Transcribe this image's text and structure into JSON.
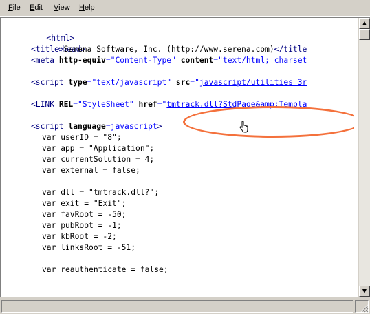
{
  "menu": [
    {
      "label": "File"
    },
    {
      "label": "Edit"
    },
    {
      "label": "View"
    },
    {
      "label": "Help"
    }
  ],
  "code": {
    "l1": "<html>",
    "l2": "<head>",
    "title_open": "<title>",
    "title_text": "Serena Software, Inc. (http://www.serena.com)",
    "title_close": "</title",
    "meta_open": "<meta",
    "meta_attr1": "http-equiv",
    "meta_val1": "\"Content-Type\"",
    "meta_attr2": "content",
    "meta_val2": "\"text/html; charset",
    "script1_open": "<script",
    "script1_attr1": "type",
    "script1_val1": "\"text/javascript\"",
    "script1_attr2": "src",
    "script1_val2_q": "\"",
    "script1_val2": "javascript/utilities 3r",
    "link_open": "<LINK",
    "link_attr1": "REL",
    "link_val1": "\"StyleSheet\"",
    "link_attr2": "href",
    "link_val2_q": "\"",
    "link_val2": "tmtrack.dll?StdPage&amp;Templa",
    "script2_open": "<script",
    "script2_attr": "language",
    "script2_val": "javascript",
    "script2_close": ">",
    "v1": "var userID = \"8\";",
    "v2": "var app = \"Application\";",
    "v3": "var currentSolution = 4;",
    "v4": "var external = false;",
    "v5": "var dll = \"tmtrack.dll?\";",
    "v6": "var exit = \"Exit\";",
    "v7": "var favRoot = -50;",
    "v8": "var pubRoot = -1;",
    "v9": "var kbRoot = -2;",
    "v10": "var linksRoot = -51;",
    "v11": "var reauthenticate = false;"
  },
  "colors": {
    "tag": "#000080",
    "value": "#0000ff",
    "highlight": "#f4713c"
  },
  "icons": {
    "scroll_up": "scroll-up-arrow-icon",
    "scroll_down": "scroll-down-arrow-icon",
    "cursor": "hand-cursor-icon",
    "grip": "resize-grip-icon"
  }
}
